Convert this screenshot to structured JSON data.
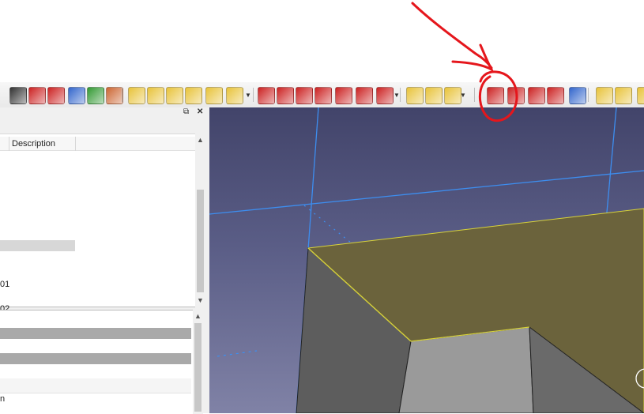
{
  "toolbar": {
    "icons": [
      {
        "name": "line-icon",
        "color": "#333333"
      },
      {
        "name": "sketch-diamond-icon",
        "color": "#cc2222"
      },
      {
        "name": "axis-icon",
        "color": "#cc2222"
      },
      {
        "name": "shapes-blue-icon",
        "color": "#3366cc"
      },
      {
        "name": "shapes-green-icon",
        "color": "#339933"
      },
      {
        "name": "cow-icon",
        "color": "#cc6633"
      },
      {
        "name": "pad-icon",
        "color": "#e8c33a"
      },
      {
        "name": "revolution-icon",
        "color": "#e8c33a"
      },
      {
        "name": "additive-loft-icon",
        "color": "#e8c33a"
      },
      {
        "name": "additive-pipe-icon",
        "color": "#e8c33a"
      },
      {
        "name": "additive-helix-icon",
        "color": "#e8c33a"
      },
      {
        "name": "additive-primitive-icon",
        "color": "#e8c33a"
      },
      {
        "name": "pocket-icon",
        "color": "#cc2222"
      },
      {
        "name": "hole-icon",
        "color": "#cc2222"
      },
      {
        "name": "groove-icon",
        "color": "#cc2222"
      },
      {
        "name": "subtractive-loft-icon",
        "color": "#cc2222"
      },
      {
        "name": "subtractive-pipe-icon",
        "color": "#cc2222"
      },
      {
        "name": "subtractive-helix-icon",
        "color": "#cc2222"
      },
      {
        "name": "subtractive-primitive-icon",
        "color": "#cc2222"
      },
      {
        "name": "mirrored-icon",
        "color": "#e8c33a"
      },
      {
        "name": "linear-pattern-icon",
        "color": "#e8c33a"
      },
      {
        "name": "polar-pattern-icon",
        "color": "#e8c33a"
      },
      {
        "name": "fillet-icon",
        "color": "#cc2222"
      },
      {
        "name": "chamfer-icon",
        "color": "#cc2222"
      },
      {
        "name": "draft-icon",
        "color": "#cc2222"
      },
      {
        "name": "thickness-icon",
        "color": "#cc2222"
      },
      {
        "name": "boolean-icon",
        "color": "#3366cc"
      },
      {
        "name": "measure-icon",
        "color": "#e8c33a"
      },
      {
        "name": "sketcher-icon",
        "color": "#e8c33a"
      },
      {
        "name": "workbench-icon",
        "color": "#e8c33a"
      }
    ]
  },
  "tree": {
    "description_header": "Description",
    "rows": [
      "01",
      "02"
    ]
  },
  "props": {
    "rows": [
      "",
      "",
      "",
      "n"
    ]
  },
  "colors": {
    "annotation": "#e5161c",
    "highlight": "#f2b630",
    "face_highlight": "#6b633c"
  }
}
